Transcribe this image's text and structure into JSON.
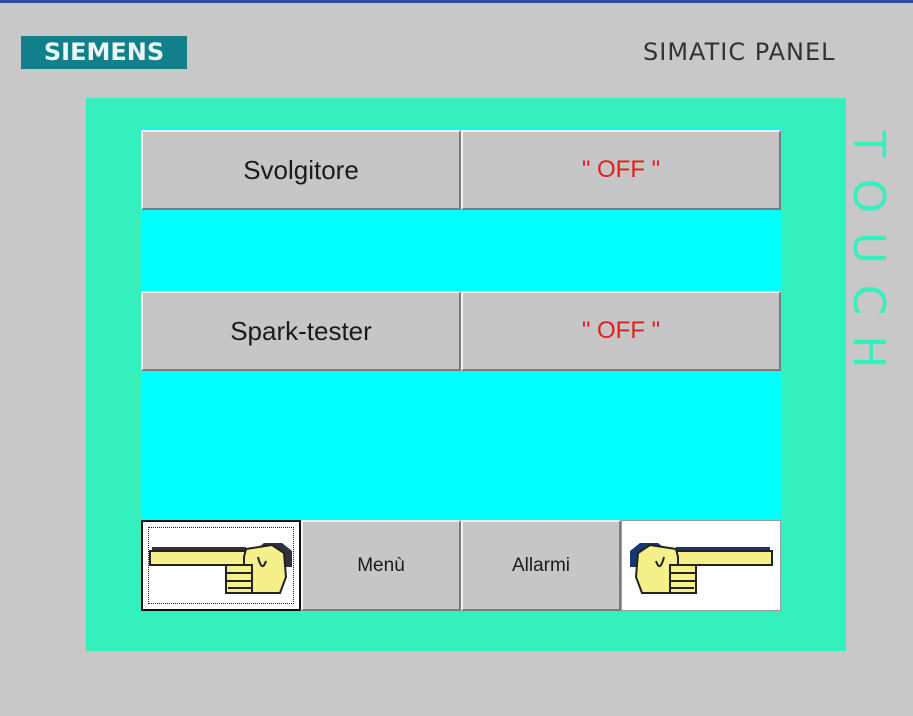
{
  "header": {
    "brand": "SIEMENS",
    "model": "SIMATIC PANEL",
    "touch_label": "TOUCH"
  },
  "rows": [
    {
      "label": "Svolgitore",
      "status": "\" OFF \""
    },
    {
      "label": "Spark-tester",
      "status": "\" OFF \""
    }
  ],
  "nav": {
    "back_icon": "pointing-hand-left-icon",
    "menu_label": "Menù",
    "alarm_label": "Allarmi",
    "forward_icon": "pointing-hand-right-icon"
  },
  "colors": {
    "brand_bg": "#11808a",
    "bezel": "#33f0bd",
    "screen": "#00ffff",
    "button": "#c6c6c6",
    "status_text": "#e0201a"
  }
}
